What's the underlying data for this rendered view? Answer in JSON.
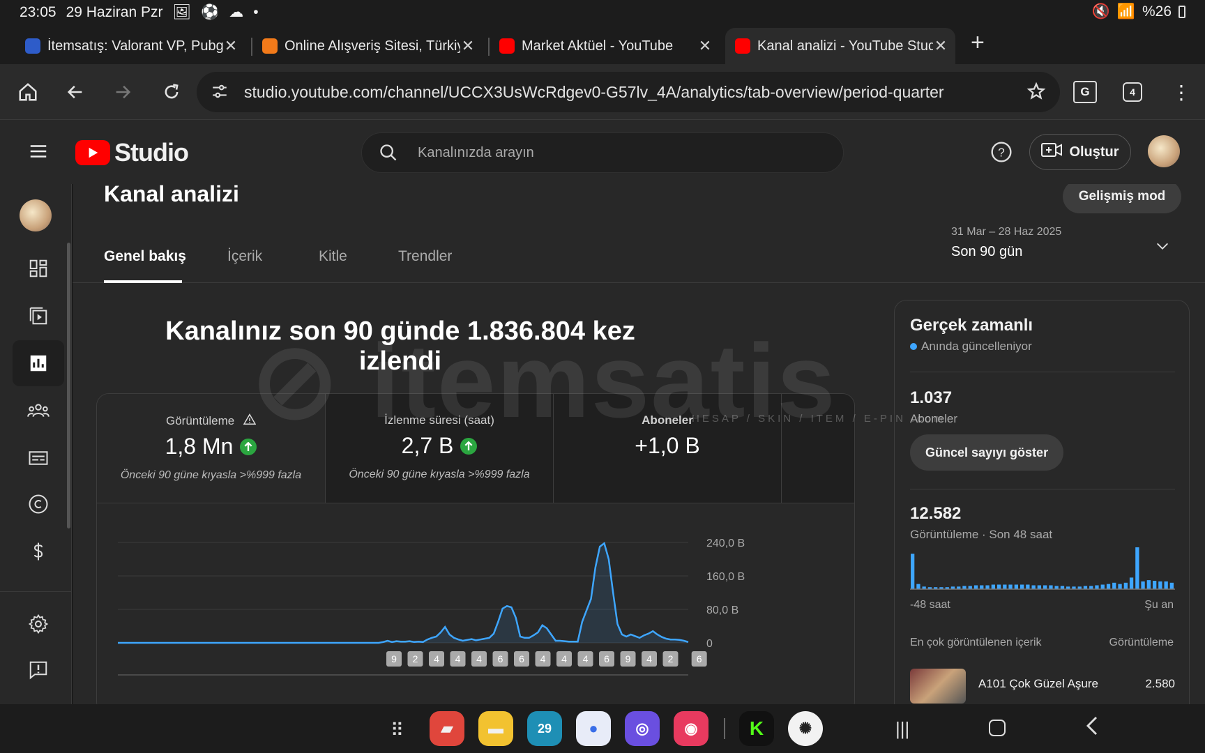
{
  "status": {
    "time": "23:05",
    "date": "29 Haziran Pzr",
    "battery": "%26"
  },
  "tabs": [
    {
      "title": "İtemsatış: Valorant VP, Pubg",
      "favicon_color": "#2e5cc9"
    },
    {
      "title": "Online Alışveriş Sitesi, Türkiy",
      "favicon_color": "#f27a1a"
    },
    {
      "title": "Market Aktüel - YouTube",
      "favicon_color": "#ff0000"
    },
    {
      "title": "Kanal analizi - YouTube Stud",
      "favicon_color": "#ff0000"
    }
  ],
  "toolbar": {
    "url": "studio.youtube.com/channel/UCCX3UsWcRdgev0-G57lv_4A/analytics/tab-overview/period-quarter",
    "tab_count": "4"
  },
  "header": {
    "logo_text": "Studio",
    "search_placeholder": "Kanalınızda arayın",
    "create_label": "Oluştur"
  },
  "page": {
    "title": "Kanal analizi",
    "advanced_mode": "Gelişmiş mod",
    "tabs": [
      "Genel bakış",
      "İçerik",
      "Kitle",
      "Trendler"
    ],
    "date_range": "31 Mar – 28 Haz 2025",
    "period": "Son 90 gün",
    "headline": "Kanalınız son 90 günde 1.836.804 kez izlendi"
  },
  "metrics": [
    {
      "label": "Görüntüleme",
      "value": "1,8 Mn",
      "comparison": "Önceki 90 güne kıyasla >%999 fazla"
    },
    {
      "label": "İzlenme süresi (saat)",
      "value": "2,7 B",
      "comparison": "Önceki 90 güne kıyasla >%999 fazla"
    },
    {
      "label": "Aboneler",
      "value": "+1,0 B",
      "comparison": ""
    }
  ],
  "chart_data": {
    "type": "line",
    "y_ticks": [
      "240,0 B",
      "160,0 B",
      "80,0 B",
      "0"
    ],
    "ylim": [
      0,
      240
    ],
    "values": [
      0,
      0,
      0,
      0,
      0,
      0,
      0,
      0,
      0,
      0,
      0,
      0,
      0,
      0,
      0,
      0,
      0,
      0,
      0,
      0,
      0,
      0,
      0,
      0,
      0,
      0,
      0,
      0,
      0,
      0,
      0,
      0,
      0,
      0,
      0,
      0,
      0,
      0,
      0,
      0,
      0,
      0,
      0,
      0,
      0,
      0,
      0,
      0,
      0,
      0,
      0,
      0,
      0,
      0,
      0,
      0,
      0,
      0,
      0,
      0,
      2,
      5,
      2,
      4,
      3,
      3,
      4,
      2,
      3,
      2,
      8,
      12,
      15,
      25,
      38,
      20,
      12,
      8,
      5,
      7,
      9,
      6,
      8,
      10,
      12,
      22,
      50,
      82,
      88,
      85,
      60,
      15,
      12,
      12,
      18,
      25,
      42,
      35,
      20,
      5,
      5,
      4,
      3,
      3,
      3,
      50,
      78,
      105,
      180,
      230,
      238,
      200,
      120,
      45,
      20,
      15,
      20,
      16,
      12,
      18,
      22,
      28,
      20,
      14,
      10,
      8,
      8,
      7,
      5,
      2
    ],
    "upload_markers": [
      "9",
      "2",
      "4",
      "4",
      "4",
      "6",
      "6",
      "4",
      "4",
      "4",
      "6",
      "9",
      "4",
      "2",
      "6"
    ],
    "grid": true
  },
  "realtime": {
    "title": "Gerçek zamanlı",
    "live_text": "Anında güncelleniyor",
    "subscribers_value": "1.037",
    "subscribers_label": "Aboneler",
    "show_count_button": "Güncel sayıyı göster",
    "views_value": "12.582",
    "views_label": "Görüntüleme · Son 48 saat",
    "axis_start": "-48 saat",
    "axis_end": "Şu an",
    "bars": [
      55,
      8,
      4,
      3,
      3,
      3,
      3,
      4,
      4,
      5,
      5,
      6,
      6,
      6,
      7,
      7,
      7,
      7,
      7,
      7,
      7,
      6,
      6,
      6,
      6,
      5,
      5,
      4,
      4,
      4,
      5,
      5,
      6,
      7,
      8,
      10,
      8,
      10,
      18,
      65,
      12,
      14,
      13,
      12,
      12,
      10
    ],
    "top_content_label": "En çok görüntülenen içerik",
    "top_content_metric": "Görüntüleme",
    "top_item_title": "A101 Çok Güzel Aşure",
    "top_item_views": "2.580"
  },
  "watermark": {
    "brand": "itemsatis",
    "tagline": "HESAP / SKIN / ITEM / E-PIN",
    "suffix": ".com"
  },
  "colors": {
    "accent": "#3ea6ff",
    "youtube_red": "#ff0000",
    "up_green": "#2ba640"
  }
}
